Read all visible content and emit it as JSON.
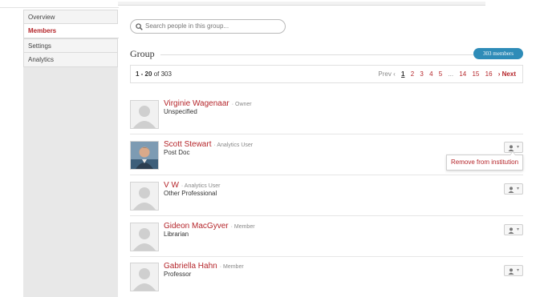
{
  "sidebar": {
    "items": [
      {
        "label": "Overview",
        "active": false
      },
      {
        "label": "Members",
        "active": true
      },
      {
        "label": "Settings",
        "active": false
      },
      {
        "label": "Analytics",
        "active": false
      }
    ]
  },
  "search": {
    "placeholder": "Search people in this group..."
  },
  "group": {
    "title": "Group",
    "members_badge": "303 members"
  },
  "pager": {
    "range_start": "1 - 20",
    "range_of": "of 303",
    "prev": "Prev ‹",
    "current": "1",
    "pages": [
      "2",
      "3",
      "4",
      "5"
    ],
    "ellipsis": "...",
    "tail_pages": [
      "14",
      "15",
      "16"
    ],
    "next": "› Next"
  },
  "members": [
    {
      "name": "Virginie Wagenaar",
      "role": "· Owner",
      "title": "Unspecified",
      "has_photo": false,
      "has_action": false
    },
    {
      "name": "Scott Stewart",
      "role": "· Analytics User",
      "title": "Post Doc",
      "has_photo": true,
      "has_action": true
    },
    {
      "name": "V W",
      "role": "· Analytics User",
      "title": "Other Professional",
      "has_photo": false,
      "has_action": true
    },
    {
      "name": "Gideon MacGyver",
      "role": "· Member",
      "title": "Librarian",
      "has_photo": false,
      "has_action": true
    },
    {
      "name": "Gabriella Hahn",
      "role": "· Member",
      "title": "Professor",
      "has_photo": false,
      "has_action": true
    }
  ],
  "popover": {
    "label": "Remove from institution"
  },
  "icons": {
    "search": "search-icon",
    "user": "user-icon",
    "caret": "caret-down-icon"
  },
  "colors": {
    "accent": "#b5262b",
    "badge": "#2e8cb8"
  }
}
